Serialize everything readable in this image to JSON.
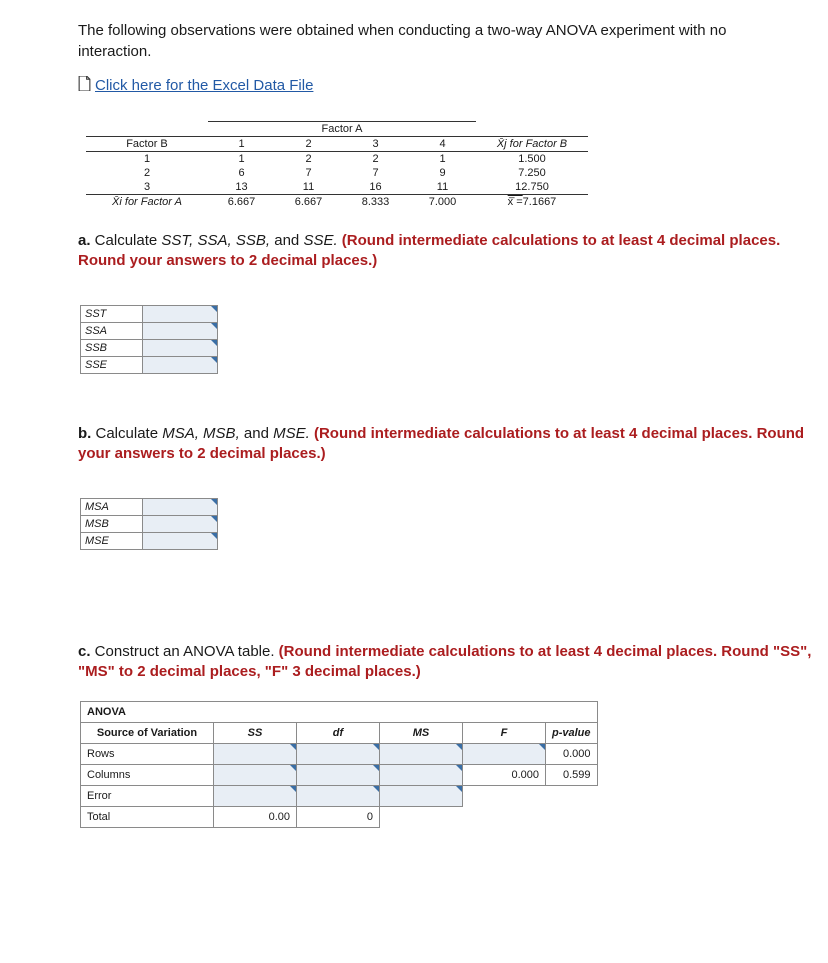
{
  "intro": "The following observations were obtained when conducting a two-way ANOVA experiment with no interaction.",
  "excelLink": "Click here for the Excel Data File",
  "dataTable": {
    "factorAHeader": "Factor A",
    "factorBHeader": "Factor B",
    "cols": [
      "1",
      "2",
      "3",
      "4"
    ],
    "rowMeanHeader": "X̄j for Factor B",
    "rows": [
      {
        "b": "1",
        "v": [
          "1",
          "2",
          "2",
          "1"
        ],
        "mean": "1.500"
      },
      {
        "b": "2",
        "v": [
          "6",
          "7",
          "7",
          "9"
        ],
        "mean": "7.250"
      },
      {
        "b": "3",
        "v": [
          "13",
          "11",
          "16",
          "11"
        ],
        "mean": "12.750"
      }
    ],
    "colMeanHeader": "X̄i for Factor A",
    "colMeans": [
      "6.667",
      "6.667",
      "8.333",
      "7.000"
    ],
    "grandMeanLabel": "x̄̄ = ",
    "grandMean": "7.1667"
  },
  "qa": {
    "prefix": "a.",
    "text1": " Calculate ",
    "fns": "SST, SSA, SSB,",
    "and": " and ",
    "fns2": "SSE.",
    "red": "(Round intermediate calculations to at least 4 decimal places. Round your answers to 2 decimal places.)",
    "rows": [
      "SST",
      "SSA",
      "SSB",
      "SSE"
    ]
  },
  "qb": {
    "prefix": "b.",
    "text1": " Calculate ",
    "fns": "MSA, MSB,",
    "and": " and ",
    "fns2": "MSE.",
    "red": "(Round intermediate calculations to at least 4 decimal places. Round your answers to 2 decimal places.)",
    "rows": [
      "MSA",
      "MSB",
      "MSE"
    ]
  },
  "qc": {
    "prefix": "c.",
    "text": " Construct an ANOVA table. ",
    "red": "(Round intermediate calculations to at least 4 decimal places. Round \"SS\", \"MS\" to 2 decimal places, \"F\" 3 decimal places.)",
    "title": "ANOVA",
    "headers": [
      "Source of Variation",
      "SS",
      "df",
      "MS",
      "F",
      "p-value"
    ],
    "rows": [
      {
        "label": "Rows",
        "ss": "",
        "df": "",
        "ms": "",
        "f": "",
        "p": "0.000"
      },
      {
        "label": "Columns",
        "ss": "",
        "df": "",
        "ms": "",
        "f": "0.000",
        "p": "0.599"
      },
      {
        "label": "Error",
        "ss": "",
        "df": "",
        "ms": "",
        "f": null,
        "p": null
      },
      {
        "label": "Total",
        "ss": "0.00",
        "df": "0",
        "ms": null,
        "f": null,
        "p": null
      }
    ]
  },
  "chart_data": {
    "type": "table",
    "title": "Two-way ANOVA data (Factor A columns × Factor B rows)",
    "factorA_levels": [
      1,
      2,
      3,
      4
    ],
    "factorB_levels": [
      1,
      2,
      3
    ],
    "cells": [
      [
        1,
        2,
        2,
        1
      ],
      [
        6,
        7,
        7,
        9
      ],
      [
        13,
        11,
        16,
        11
      ]
    ],
    "row_means_factorB": [
      1.5,
      7.25,
      12.75
    ],
    "col_means_factorA": [
      6.667,
      6.667,
      8.333,
      7.0
    ],
    "grand_mean": 7.1667
  }
}
